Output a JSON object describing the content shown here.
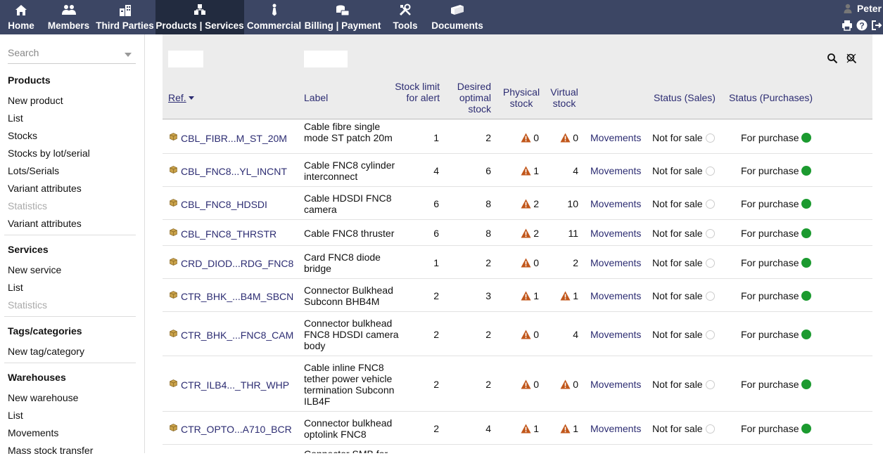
{
  "nav": {
    "items": [
      {
        "label": "Home",
        "icon": "home-icon"
      },
      {
        "label": "Members",
        "icon": "members-icon"
      },
      {
        "label": "Third Parties",
        "icon": "building-icon"
      },
      {
        "label": "Products | Services",
        "icon": "cubes-icon"
      },
      {
        "label": "Commercial",
        "icon": "tie-icon"
      },
      {
        "label": "Billing | Payment",
        "icon": "money-icon"
      },
      {
        "label": "Tools",
        "icon": "tools-icon"
      },
      {
        "label": "Documents",
        "icon": "folder-icon"
      }
    ],
    "active_index": 3,
    "user_name": "Peter"
  },
  "leftmenu": {
    "search_placeholder": "Search",
    "sections": [
      {
        "title": "Products",
        "items": [
          {
            "label": "New product",
            "disabled": false
          },
          {
            "label": "List",
            "disabled": false
          },
          {
            "label": "Stocks",
            "disabled": false
          },
          {
            "label": "Stocks by lot/serial",
            "disabled": false
          },
          {
            "label": "Lots/Serials",
            "disabled": false
          },
          {
            "label": "Variant attributes",
            "disabled": false
          },
          {
            "label": "Statistics",
            "disabled": true
          },
          {
            "label": "Variant attributes",
            "disabled": false
          }
        ]
      },
      {
        "title": "Services",
        "items": [
          {
            "label": "New service",
            "disabled": false
          },
          {
            "label": "List",
            "disabled": false
          },
          {
            "label": "Statistics",
            "disabled": true
          }
        ]
      },
      {
        "title": "Tags/categories",
        "items": [
          {
            "label": "New tag/category",
            "disabled": false
          }
        ]
      },
      {
        "title": "Warehouses",
        "items": [
          {
            "label": "New warehouse",
            "disabled": false
          },
          {
            "label": "List",
            "disabled": false
          },
          {
            "label": "Movements",
            "disabled": false
          },
          {
            "label": "Mass stock transfer",
            "disabled": false
          }
        ]
      }
    ]
  },
  "table": {
    "headers": {
      "ref": "Ref.",
      "label": "Label",
      "stock_limit": "Stock limit for alert",
      "desired": "Desired optimal stock",
      "physical": "Physical stock",
      "virtual": "Virtual stock",
      "status_sales": "Status (Sales)",
      "status_purchases": "Status (Purchases)"
    },
    "movements_label": "Movements",
    "rows": [
      {
        "ref": "CBL_FIBR...M_ST_20M",
        "label": "Cable fibre single mode ST patch 20m",
        "limit": "1",
        "desired": "2",
        "physical": "0",
        "physical_warn": true,
        "virtual": "0",
        "virtual_warn": true,
        "sale": "Not for sale",
        "purchase": "For purchase"
      },
      {
        "ref": "CBL_FNC8...YL_INCNT",
        "label": "Cable FNC8 cylinder interconnect",
        "limit": "4",
        "desired": "6",
        "physical": "1",
        "physical_warn": true,
        "virtual": "4",
        "virtual_warn": false,
        "sale": "Not for sale",
        "purchase": "For purchase"
      },
      {
        "ref": "CBL_FNC8_HDSDI",
        "label": "Cable HDSDI FNC8 camera",
        "limit": "6",
        "desired": "8",
        "physical": "2",
        "physical_warn": true,
        "virtual": "10",
        "virtual_warn": false,
        "sale": "Not for sale",
        "purchase": "For purchase"
      },
      {
        "ref": "CBL_FNC8_THRSTR",
        "label": "Cable FNC8 thruster",
        "limit": "6",
        "desired": "8",
        "physical": "2",
        "physical_warn": true,
        "virtual": "11",
        "virtual_warn": false,
        "sale": "Not for sale",
        "purchase": "For purchase"
      },
      {
        "ref": "CRD_DIOD...RDG_FNC8",
        "label": "Card FNC8 diode bridge",
        "limit": "1",
        "desired": "2",
        "physical": "0",
        "physical_warn": true,
        "virtual": "2",
        "virtual_warn": false,
        "sale": "Not for sale",
        "purchase": "For purchase"
      },
      {
        "ref": "CTR_BHK_...B4M_SBCN",
        "label": "Connector Bulkhead Subconn BHB4M",
        "limit": "2",
        "desired": "3",
        "physical": "1",
        "physical_warn": true,
        "virtual": "1",
        "virtual_warn": true,
        "sale": "Not for sale",
        "purchase": "For purchase"
      },
      {
        "ref": "CTR_BHK_...FNC8_CAM",
        "label": "Connector bulkhead FNC8 HDSDI camera body",
        "limit": "2",
        "desired": "2",
        "physical": "0",
        "physical_warn": true,
        "virtual": "4",
        "virtual_warn": false,
        "sale": "Not for sale",
        "purchase": "For purchase"
      },
      {
        "ref": "CTR_ILB4..._THR_WHP",
        "label": "Cable inline FNC8 tether power vehicle termination Subconn ILB4F",
        "limit": "2",
        "desired": "2",
        "physical": "0",
        "physical_warn": true,
        "virtual": "0",
        "virtual_warn": true,
        "sale": "Not for sale",
        "purchase": "For purchase"
      },
      {
        "ref": "CTR_OPTO...A710_BCR",
        "label": "Connector bulkhead optolink FNC8",
        "limit": "2",
        "desired": "4",
        "physical": "1",
        "physical_warn": true,
        "virtual": "1",
        "virtual_warn": true,
        "sale": "Not for sale",
        "purchase": "For purchase"
      }
    ],
    "partial_last_label": "Connector SMB for"
  },
  "colors": {
    "topbar": "#3c4664",
    "topbar_active": "#222b3f",
    "link": "#2c2c72",
    "warn": "#c1561a",
    "on_status": "#1b9a2f"
  }
}
